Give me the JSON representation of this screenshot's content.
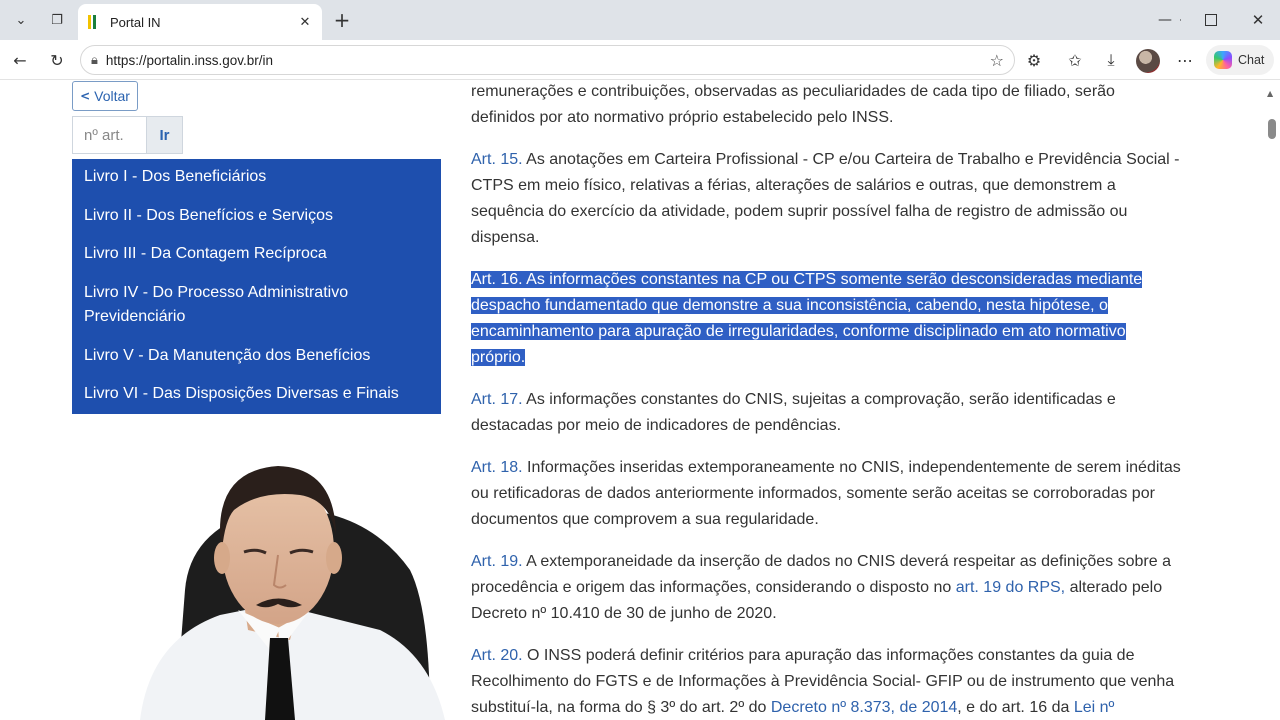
{
  "browser": {
    "tab_title": "Portal IN",
    "url": "https://portalin.inss.gov.br/in",
    "copilot_label": "Chat"
  },
  "sidebar": {
    "back_label": "Voltar",
    "article_placeholder": "nº art.",
    "go_label": "Ir",
    "books": [
      "Livro I - Dos Beneficiários",
      "Livro II - Dos Benefícios e Serviços",
      "Livro III - Da Contagem Recíproca",
      "Livro IV - Do Processo Administrativo Previdenciário",
      "Livro V - Da Manutenção dos Benefícios",
      "Livro VI - Das Disposições Diversas e Finais"
    ]
  },
  "content": {
    "intro": "remunerações e contribuições, observadas as peculiaridades de cada tipo de filiado, serão definidos por ato normativo próprio estabelecido pelo INSS.",
    "art15_label": "Art. 15.",
    "art15_text": " As anotações em Carteira Profissional - CP e/ou Carteira de Trabalho e Previdência Social - CTPS em meio físico, relativas a férias, alterações de salários e outras, que demonstrem a sequência do exercício da atividade, podem suprir possível falha de registro de admissão ou dispensa.",
    "art16_label": "Art. 16.",
    "art16_text": " As informações constantes na CP ou CTPS somente serão desconsideradas mediante despacho fundamentado que demonstre a sua inconsistência, cabendo, nesta hipótese, o encaminhamento para apuração de irregularidades, conforme disciplinado em ato normativo próprio.",
    "art17_label": "Art. 17.",
    "art17_text": " As informações constantes do CNIS, sujeitas a comprovação, serão identificadas e destacadas por meio de indicadores de pendências.",
    "art18_label": "Art. 18.",
    "art18_text": " Informações inseridas extemporaneamente no CNIS, independentemente de serem inéditas ou retificadoras de dados anteriormente informados, somente serão aceitas se corroboradas por documentos que comprovem a sua regularidade.",
    "art19_label": "Art. 19.",
    "art19_text_a": " A extemporaneidade da inserção de dados no CNIS deverá respeitar as definições sobre a procedência e origem das informações, considerando o disposto no ",
    "art19_link": "art. 19 do RPS,",
    "art19_text_b": " alterado pelo Decreto nº 10.410 de 30 de junho de 2020.",
    "art20_label": "Art. 20.",
    "art20_text_a": " O INSS poderá definir critérios para apuração das informações constantes da guia de Recolhimento do FGTS e de Informações à Previdência Social- GFIP ou de instrumento que venha substituí-la, na forma do § 3º do art. 2º do ",
    "art20_link1": "Decreto nº 8.373, de 2014",
    "art20_text_b": ", e do art. 16 da ",
    "art20_link2": "Lei nº"
  }
}
